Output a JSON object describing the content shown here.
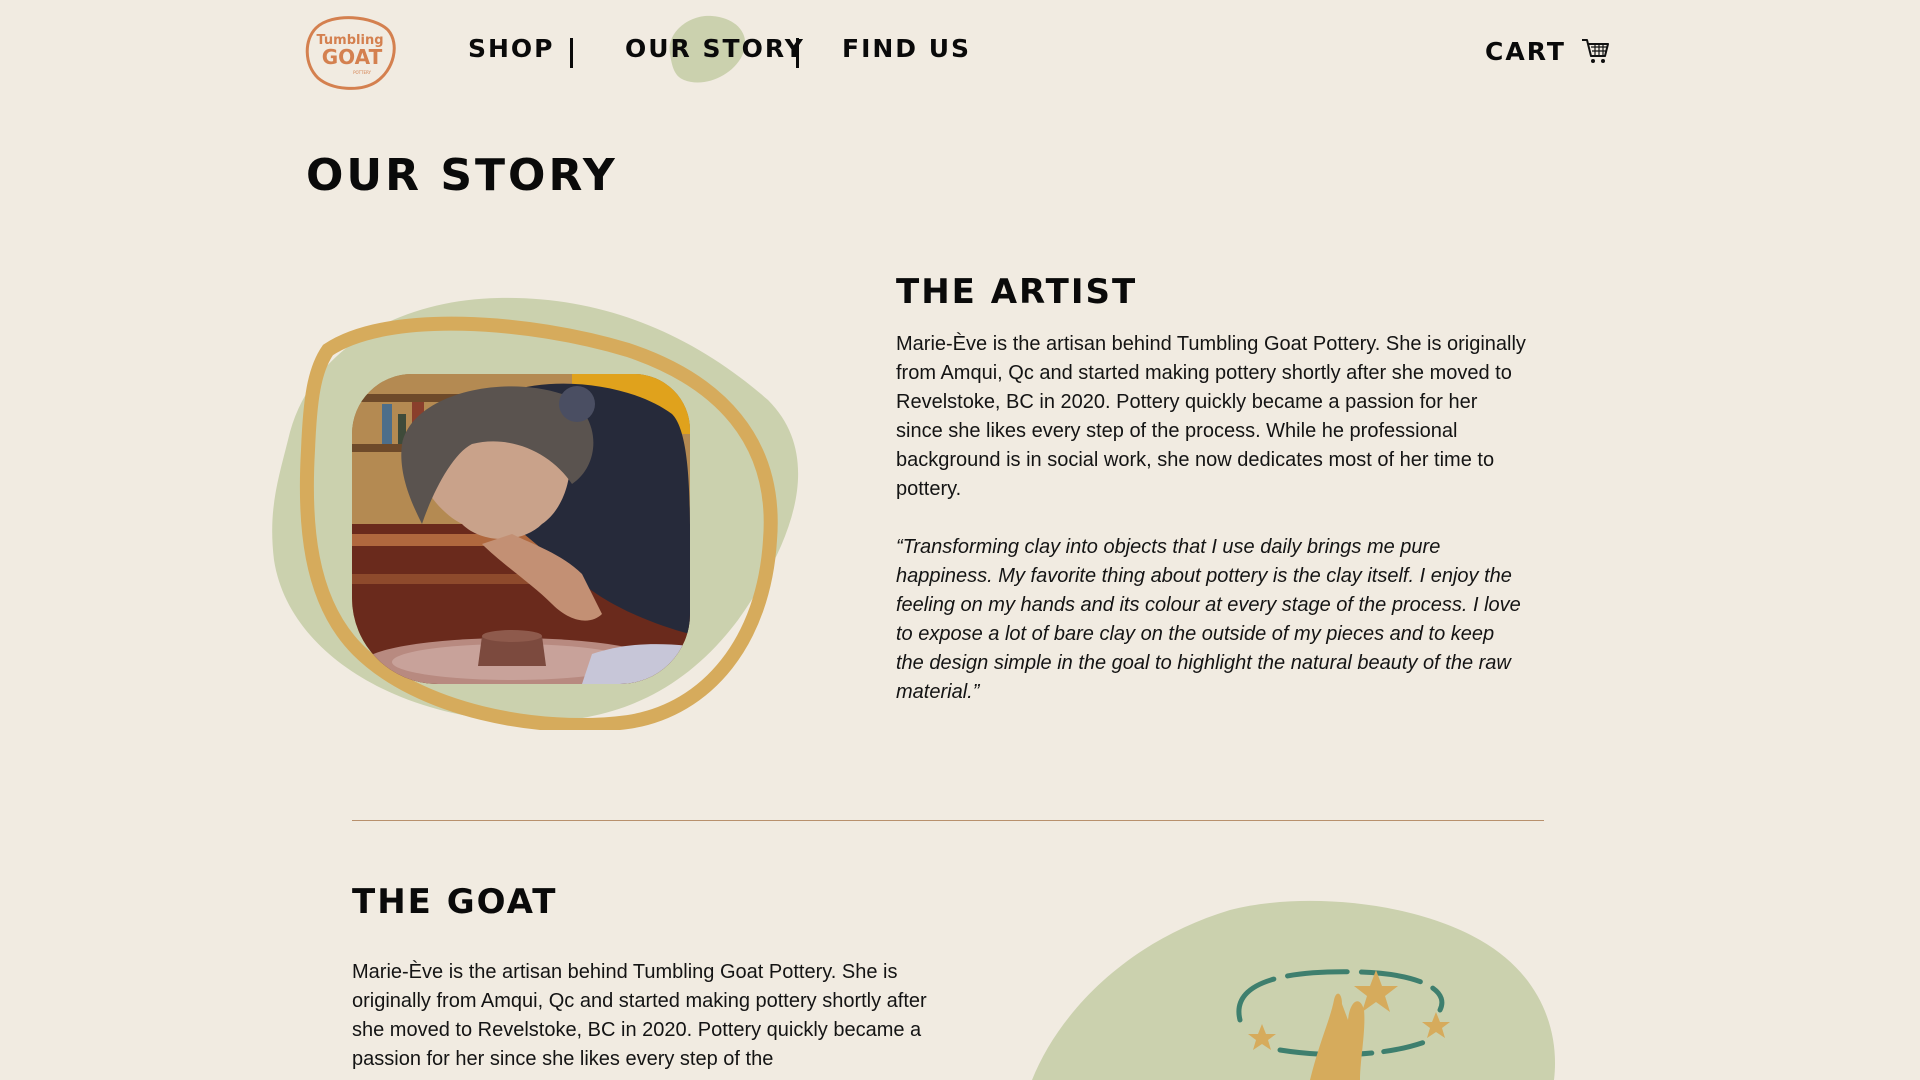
{
  "brand": {
    "logo_line1": "Tumbling",
    "logo_line2": "GOAT",
    "logo_line3": "POTTERY",
    "logo_color": "#d4804f"
  },
  "nav": {
    "items": [
      {
        "label": "SHOP"
      },
      {
        "label": "OUR STORY",
        "active": true
      },
      {
        "label": "FIND US"
      }
    ],
    "cart_label": "CART",
    "cart_icon": "shopping-cart-icon"
  },
  "page": {
    "title": "OUR STORY"
  },
  "artist": {
    "heading": "THE ARTIST",
    "bio": "Marie-Ève is the artisan behind Tumbling Goat Pottery. She is originally from Amqui, Qc and started making pottery shortly after she moved to Revelstoke, BC in 2020. Pottery quickly became a passion for her since she likes every step of the process. While he professional background is in social work, she now dedicates most of her time to pottery.",
    "quote": "“Transforming clay into objects that I use daily brings me pure happiness. My favorite thing about pottery is the clay itself. I enjoy the feeling on my hands and its colour at every stage of the process. I love to expose a lot of bare clay on the outside of my pieces and to keep the design simple in the goal to highlight the natural beauty of the raw material.”"
  },
  "goat": {
    "heading": "THE GOAT",
    "bio": "Marie-Ève is the artisan behind Tumbling Goat Pottery. She is originally from Amqui, Qc and started making pottery shortly after she moved to Revelstoke, BC in 2020. Pottery quickly became a passion for her since she likes every step of the"
  },
  "colors": {
    "background": "#f1ebe1",
    "sage": "#cbd1ae",
    "ochre": "#d6ab5c",
    "divider": "#b8906c",
    "teal": "#3e7f6e"
  }
}
